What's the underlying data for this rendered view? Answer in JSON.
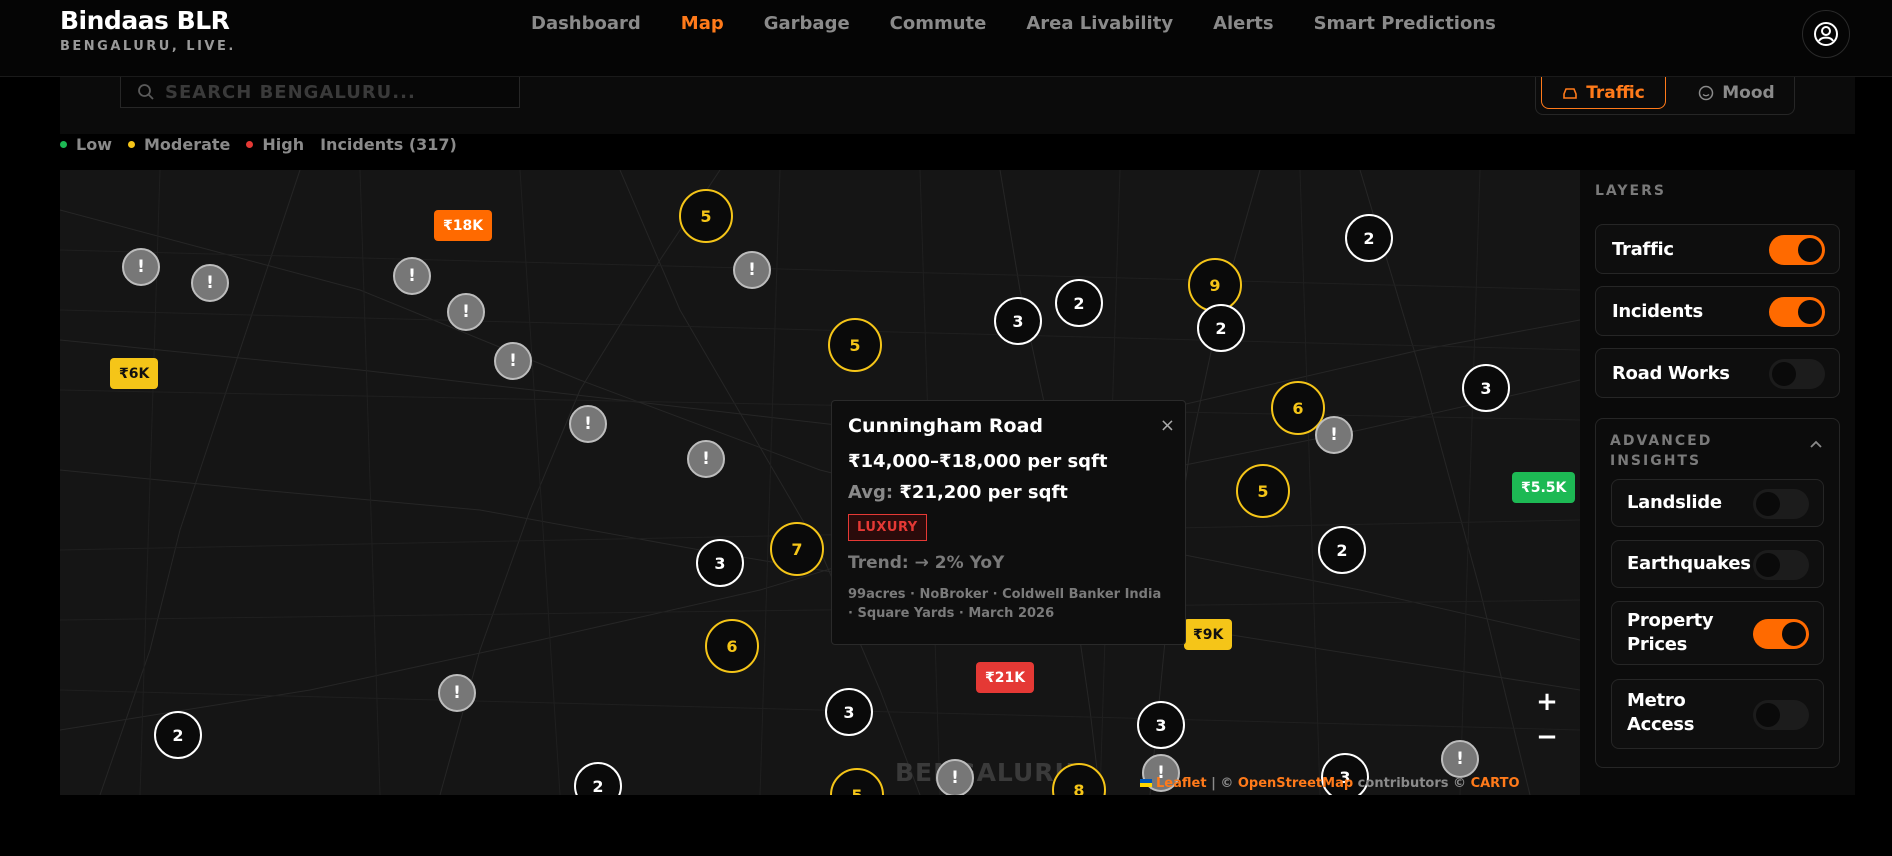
{
  "app": {
    "title": "Bindaas BLR",
    "subtitle": "BENGALURU, LIVE."
  },
  "nav": {
    "items": [
      {
        "label": "Dashboard",
        "active": false
      },
      {
        "label": "Map",
        "active": true
      },
      {
        "label": "Garbage",
        "active": false
      },
      {
        "label": "Commute",
        "active": false
      },
      {
        "label": "Area Livability",
        "active": false
      },
      {
        "label": "Alerts",
        "active": false
      },
      {
        "label": "Smart Predictions",
        "active": false
      }
    ],
    "account_icon": "user-circle-icon"
  },
  "search": {
    "placeholder": "SEARCH BENGALURU..."
  },
  "mode_toggle": {
    "traffic_label": "Traffic",
    "mood_label": "Mood",
    "active": "Traffic"
  },
  "legend": {
    "low": "Low",
    "moderate": "Moderate",
    "high": "High",
    "incidents": "Incidents (317)",
    "colors": {
      "low": "#1db954",
      "moderate": "#f5c518",
      "high": "#e53935"
    }
  },
  "map": {
    "city_label": "BENGALURU",
    "clusters": [
      {
        "count": "5",
        "severity": "moderate"
      },
      {
        "count": "2",
        "severity": "default"
      },
      {
        "count": "3",
        "severity": "default"
      },
      {
        "count": "2",
        "severity": "default"
      },
      {
        "count": "9",
        "severity": "moderate"
      },
      {
        "count": "2",
        "severity": "default"
      },
      {
        "count": "5",
        "severity": "moderate"
      },
      {
        "count": "3",
        "severity": "default"
      },
      {
        "count": "6",
        "severity": "moderate"
      },
      {
        "count": "5",
        "severity": "moderate"
      },
      {
        "count": "2",
        "severity": "default"
      },
      {
        "count": "3",
        "severity": "default"
      },
      {
        "count": "7",
        "severity": "moderate"
      },
      {
        "count": "6",
        "severity": "moderate"
      },
      {
        "count": "3",
        "severity": "default"
      },
      {
        "count": "3",
        "severity": "default"
      },
      {
        "count": "2",
        "severity": "default"
      },
      {
        "count": "2",
        "severity": "default"
      },
      {
        "count": "5",
        "severity": "moderate"
      },
      {
        "count": "8",
        "severity": "moderate"
      },
      {
        "count": "3",
        "severity": "default"
      }
    ],
    "price_markers": [
      {
        "label": "₹18K",
        "color": "orange"
      },
      {
        "label": "₹6K",
        "color": "yellow"
      },
      {
        "label": "₹5.5K",
        "color": "green"
      },
      {
        "label": "₹9K",
        "color": "yellow"
      },
      {
        "label": "₹21K",
        "color": "red"
      }
    ],
    "incident_icon": "alert-marker-icon",
    "zoom_in": "+",
    "zoom_out": "−",
    "attribution": {
      "leaflet": "Leaflet",
      "sep1": " | © ",
      "osm": "OpenStreetMap",
      "mid": " contributors © ",
      "carto": "CARTO"
    }
  },
  "popup": {
    "title": "Cunningham Road",
    "close": "×",
    "range": "₹14,000–₹18,000 per sqft",
    "avg_label": "Avg:",
    "avg_value": "₹21,200 per sqft",
    "badge": "LUXURY",
    "trend": "Trend: → 2% YoY",
    "sources": "99acres · NoBroker · Coldwell Banker India · Square Yards · March 2026"
  },
  "layers": {
    "heading": "LAYERS",
    "items": [
      {
        "label": "Traffic",
        "on": true
      },
      {
        "label": "Incidents",
        "on": true
      },
      {
        "label": "Road Works",
        "on": false
      }
    ],
    "advanced": {
      "heading": "ADVANCED INSIGHTS",
      "items": [
        {
          "label": "Landslide",
          "on": false
        },
        {
          "label": "Earthquakes",
          "on": false
        },
        {
          "label": "Property Prices",
          "on": true
        },
        {
          "label": "Metro Access",
          "on": false
        }
      ]
    }
  }
}
